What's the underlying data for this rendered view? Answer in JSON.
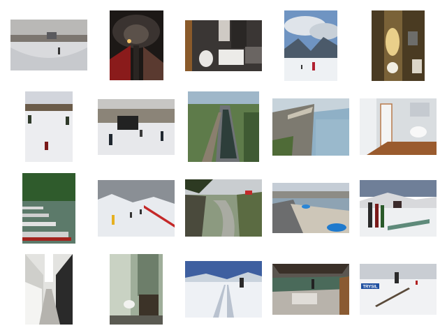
{
  "gallery": {
    "thumbnails": [
      {
        "scene": "skatepark-bowl"
      },
      {
        "scene": "restaurant-tunnel"
      },
      {
        "scene": "dark-bathroom"
      },
      {
        "scene": "mountain-skier"
      },
      {
        "scene": "lit-restroom"
      },
      {
        "scene": "ski-slope-village"
      },
      {
        "scene": "snowcat-skiers"
      },
      {
        "scene": "train-platform"
      },
      {
        "scene": "cliff-overlook"
      },
      {
        "scene": "white-bathroom"
      },
      {
        "scene": "lake-boats"
      },
      {
        "scene": "snowy-forest-skiers"
      },
      {
        "scene": "river-valley"
      },
      {
        "scene": "harbor-promenade"
      },
      {
        "scene": "snowboard-rack"
      },
      {
        "scene": "kitchen-corridor"
      },
      {
        "scene": "green-bathroom"
      },
      {
        "scene": "ski-tracks"
      },
      {
        "scene": "skate-ramp"
      },
      {
        "scene": "snowboard-rail",
        "banner_text": "TRYSIL"
      }
    ]
  }
}
